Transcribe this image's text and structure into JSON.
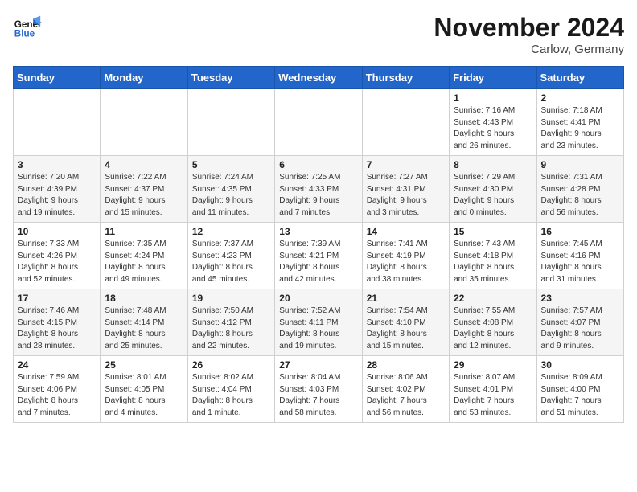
{
  "header": {
    "logo_line1": "General",
    "logo_line2": "Blue",
    "month": "November 2024",
    "location": "Carlow, Germany"
  },
  "days_of_week": [
    "Sunday",
    "Monday",
    "Tuesday",
    "Wednesday",
    "Thursday",
    "Friday",
    "Saturday"
  ],
  "weeks": [
    [
      {
        "day": "",
        "info": ""
      },
      {
        "day": "",
        "info": ""
      },
      {
        "day": "",
        "info": ""
      },
      {
        "day": "",
        "info": ""
      },
      {
        "day": "",
        "info": ""
      },
      {
        "day": "1",
        "info": "Sunrise: 7:16 AM\nSunset: 4:43 PM\nDaylight: 9 hours\nand 26 minutes."
      },
      {
        "day": "2",
        "info": "Sunrise: 7:18 AM\nSunset: 4:41 PM\nDaylight: 9 hours\nand 23 minutes."
      }
    ],
    [
      {
        "day": "3",
        "info": "Sunrise: 7:20 AM\nSunset: 4:39 PM\nDaylight: 9 hours\nand 19 minutes."
      },
      {
        "day": "4",
        "info": "Sunrise: 7:22 AM\nSunset: 4:37 PM\nDaylight: 9 hours\nand 15 minutes."
      },
      {
        "day": "5",
        "info": "Sunrise: 7:24 AM\nSunset: 4:35 PM\nDaylight: 9 hours\nand 11 minutes."
      },
      {
        "day": "6",
        "info": "Sunrise: 7:25 AM\nSunset: 4:33 PM\nDaylight: 9 hours\nand 7 minutes."
      },
      {
        "day": "7",
        "info": "Sunrise: 7:27 AM\nSunset: 4:31 PM\nDaylight: 9 hours\nand 3 minutes."
      },
      {
        "day": "8",
        "info": "Sunrise: 7:29 AM\nSunset: 4:30 PM\nDaylight: 9 hours\nand 0 minutes."
      },
      {
        "day": "9",
        "info": "Sunrise: 7:31 AM\nSunset: 4:28 PM\nDaylight: 8 hours\nand 56 minutes."
      }
    ],
    [
      {
        "day": "10",
        "info": "Sunrise: 7:33 AM\nSunset: 4:26 PM\nDaylight: 8 hours\nand 52 minutes."
      },
      {
        "day": "11",
        "info": "Sunrise: 7:35 AM\nSunset: 4:24 PM\nDaylight: 8 hours\nand 49 minutes."
      },
      {
        "day": "12",
        "info": "Sunrise: 7:37 AM\nSunset: 4:23 PM\nDaylight: 8 hours\nand 45 minutes."
      },
      {
        "day": "13",
        "info": "Sunrise: 7:39 AM\nSunset: 4:21 PM\nDaylight: 8 hours\nand 42 minutes."
      },
      {
        "day": "14",
        "info": "Sunrise: 7:41 AM\nSunset: 4:19 PM\nDaylight: 8 hours\nand 38 minutes."
      },
      {
        "day": "15",
        "info": "Sunrise: 7:43 AM\nSunset: 4:18 PM\nDaylight: 8 hours\nand 35 minutes."
      },
      {
        "day": "16",
        "info": "Sunrise: 7:45 AM\nSunset: 4:16 PM\nDaylight: 8 hours\nand 31 minutes."
      }
    ],
    [
      {
        "day": "17",
        "info": "Sunrise: 7:46 AM\nSunset: 4:15 PM\nDaylight: 8 hours\nand 28 minutes."
      },
      {
        "day": "18",
        "info": "Sunrise: 7:48 AM\nSunset: 4:14 PM\nDaylight: 8 hours\nand 25 minutes."
      },
      {
        "day": "19",
        "info": "Sunrise: 7:50 AM\nSunset: 4:12 PM\nDaylight: 8 hours\nand 22 minutes."
      },
      {
        "day": "20",
        "info": "Sunrise: 7:52 AM\nSunset: 4:11 PM\nDaylight: 8 hours\nand 19 minutes."
      },
      {
        "day": "21",
        "info": "Sunrise: 7:54 AM\nSunset: 4:10 PM\nDaylight: 8 hours\nand 15 minutes."
      },
      {
        "day": "22",
        "info": "Sunrise: 7:55 AM\nSunset: 4:08 PM\nDaylight: 8 hours\nand 12 minutes."
      },
      {
        "day": "23",
        "info": "Sunrise: 7:57 AM\nSunset: 4:07 PM\nDaylight: 8 hours\nand 9 minutes."
      }
    ],
    [
      {
        "day": "24",
        "info": "Sunrise: 7:59 AM\nSunset: 4:06 PM\nDaylight: 8 hours\nand 7 minutes."
      },
      {
        "day": "25",
        "info": "Sunrise: 8:01 AM\nSunset: 4:05 PM\nDaylight: 8 hours\nand 4 minutes."
      },
      {
        "day": "26",
        "info": "Sunrise: 8:02 AM\nSunset: 4:04 PM\nDaylight: 8 hours\nand 1 minute."
      },
      {
        "day": "27",
        "info": "Sunrise: 8:04 AM\nSunset: 4:03 PM\nDaylight: 7 hours\nand 58 minutes."
      },
      {
        "day": "28",
        "info": "Sunrise: 8:06 AM\nSunset: 4:02 PM\nDaylight: 7 hours\nand 56 minutes."
      },
      {
        "day": "29",
        "info": "Sunrise: 8:07 AM\nSunset: 4:01 PM\nDaylight: 7 hours\nand 53 minutes."
      },
      {
        "day": "30",
        "info": "Sunrise: 8:09 AM\nSunset: 4:00 PM\nDaylight: 7 hours\nand 51 minutes."
      }
    ]
  ]
}
